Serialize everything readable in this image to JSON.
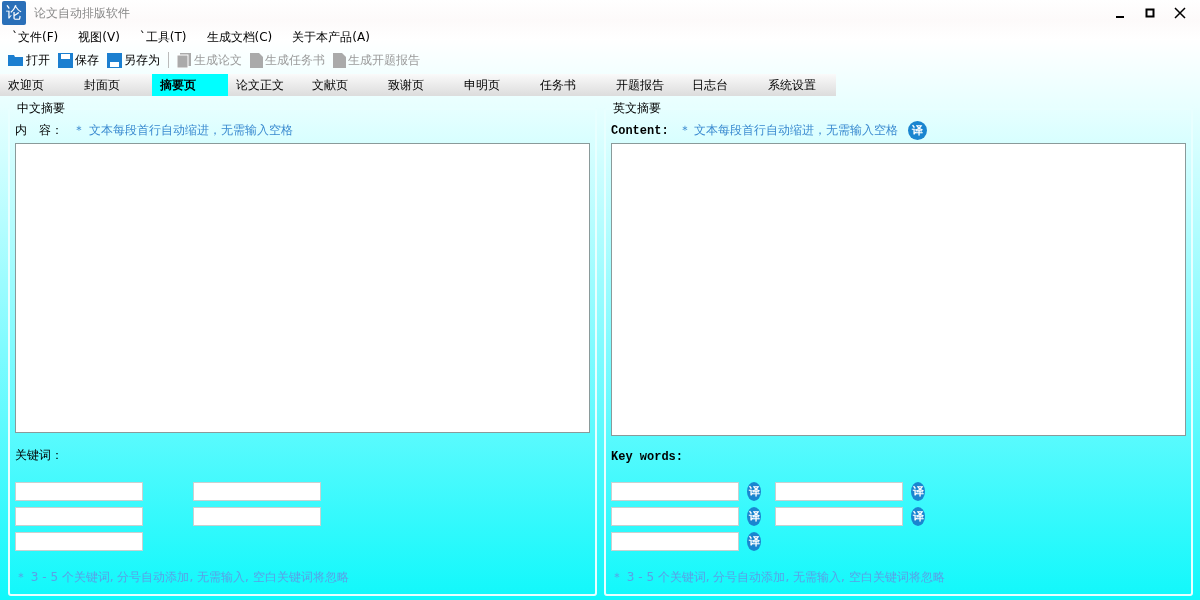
{
  "window": {
    "logo": "论",
    "title": "论文自动排版软件"
  },
  "menu": [
    "`文件(F)",
    "视图(V)",
    "`工具(T)",
    "生成文档(C)",
    "关于本产品(A)"
  ],
  "toolbar": [
    {
      "kind": "open",
      "label": "打开",
      "disabled": false
    },
    {
      "kind": "save",
      "label": "保存",
      "disabled": false
    },
    {
      "kind": "saveas",
      "label": "另存为",
      "disabled": false
    },
    {
      "kind": "doc",
      "label": "生成论文",
      "disabled": true
    },
    {
      "kind": "page",
      "label": "生成任务书",
      "disabled": true
    },
    {
      "kind": "page",
      "label": "生成开题报告",
      "disabled": true
    }
  ],
  "tabs": [
    {
      "label": "欢迎页",
      "selected": false
    },
    {
      "label": "封面页",
      "selected": false
    },
    {
      "label": "摘要页",
      "selected": true
    },
    {
      "label": "论文正文",
      "selected": false
    },
    {
      "label": "文献页",
      "selected": false
    },
    {
      "label": "致谢页",
      "selected": false
    },
    {
      "label": "申明页",
      "selected": false
    },
    {
      "label": "任务书",
      "selected": false
    },
    {
      "label": "开题报告",
      "selected": false
    },
    {
      "label": "日志台",
      "selected": false
    },
    {
      "label": "系统设置",
      "selected": false
    }
  ],
  "panels": [
    {
      "kind": "chinese",
      "title": "中文摘要",
      "content_label": "内　容：",
      "hint": "＊ 文本每段首行自动缩进，无需输入空格",
      "keywords_label": "关键词：",
      "keyword_fields": [
        {
          "kind": "plain"
        },
        {
          "kind": "plain"
        },
        {
          "kind": "plain"
        },
        {
          "kind": "plain"
        },
        {
          "kind": "plain"
        }
      ],
      "note": "＊ 3 - 5 个关键词, 分号自动添加, 无需输入, 空白关键词将忽略"
    },
    {
      "kind": "english",
      "title": "英文摘要",
      "content_label": "Content:",
      "hint": "＊ 文本每段首行自动缩进，无需输入空格",
      "translate": "译",
      "keywords_label": "Key words:",
      "keyword_fields": [
        {
          "kind": "translate",
          "translate": "译"
        },
        {
          "kind": "translate",
          "translate": "译"
        },
        {
          "kind": "translate",
          "translate": "译"
        },
        {
          "kind": "translate",
          "translate": "译"
        },
        {
          "kind": "translate",
          "translate": "译"
        }
      ],
      "note": "＊ 3 - 5 个关键词, 分号自动添加, 无需输入, 空白关键词将忽略"
    }
  ]
}
